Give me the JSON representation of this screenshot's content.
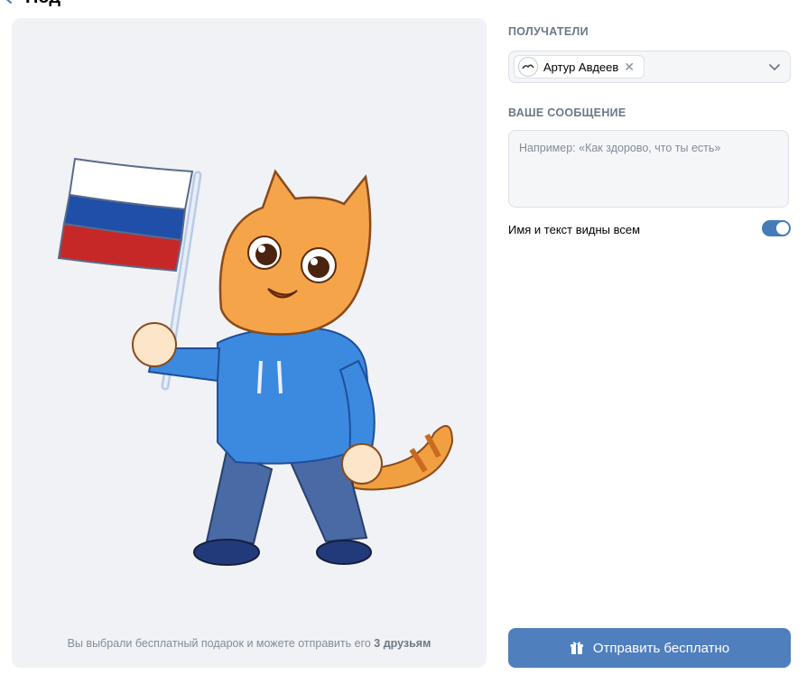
{
  "header": {
    "title_fragment": "Под"
  },
  "preview": {
    "note_prefix": "Вы выбрали бесплатный подарок и можете отправить его ",
    "note_bold": "3 друзьям",
    "sticker_icon": "cat-with-russian-flag-sticker"
  },
  "recipients": {
    "label": "ПОЛУЧАТЕЛИ",
    "chips": [
      {
        "name": "Артур Авдеев",
        "remove": "✕"
      }
    ]
  },
  "message": {
    "label": "ВАШЕ СООБЩЕНИЕ",
    "placeholder": "Например: «Как здорово, что ты есть»",
    "value": ""
  },
  "visibility": {
    "label": "Имя и текст видны всем",
    "enabled": true
  },
  "send": {
    "label": "Отправить бесплатно",
    "icon": "gift-icon"
  },
  "colors": {
    "accent": "#4f7fbd",
    "toggle": "#447bba",
    "muted": "#6d7885",
    "panel_bg": "#f0f2f5"
  }
}
